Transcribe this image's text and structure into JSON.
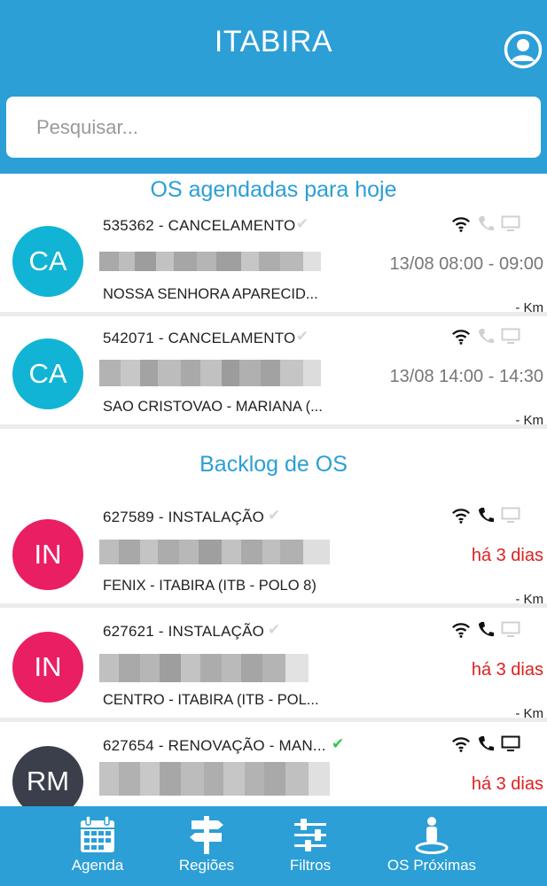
{
  "header": {
    "title": "ITABIRA"
  },
  "search": {
    "placeholder": "Pesquisar..."
  },
  "sections": {
    "today": "OS agendadas para hoje",
    "backlog": "Backlog de OS"
  },
  "orders": [
    {
      "initials": "CA",
      "code": "535362 - CANCELAMENTO",
      "time": "13/08 08:00 - 09:00",
      "place": "NOSSA SENHORA APARECID...",
      "km": "- Km",
      "confirmed": false,
      "phone": false,
      "screen": false,
      "avatar_color": "#11b4d4"
    },
    {
      "initials": "CA",
      "code": "542071 - CANCELAMENTO",
      "time": "13/08 14:00 - 14:30",
      "place": "SAO CRISTOVAO - MARIANA (...",
      "km": "- Km",
      "confirmed": false,
      "phone": false,
      "screen": false,
      "avatar_color": "#11b4d4"
    },
    {
      "initials": "IN",
      "code": "627589 - INSTALAÇÃO",
      "time": "há 3 dias",
      "place": "FENIX - ITABIRA (ITB - POLO 8)",
      "km": "- Km",
      "confirmed": false,
      "phone": true,
      "screen": false,
      "avatar_color": "#e91e63"
    },
    {
      "initials": "IN",
      "code": "627621 - INSTALAÇÃO",
      "time": "há 3 dias",
      "place": "CENTRO - ITABIRA (ITB - POL...",
      "km": "- Km",
      "confirmed": false,
      "phone": true,
      "screen": false,
      "avatar_color": "#e91e63"
    },
    {
      "initials": "RM",
      "code": "627654 - RENOVAÇÃO - MAN...",
      "time": "há 3 dias",
      "place": "",
      "km": "",
      "confirmed": true,
      "phone": true,
      "screen": true,
      "avatar_color": "#3a3f4b"
    }
  ],
  "nav": [
    {
      "label": "Agenda",
      "icon": "calendar-icon"
    },
    {
      "label": "Regiões",
      "icon": "signpost-icon"
    },
    {
      "label": "Filtros",
      "icon": "sliders-icon"
    },
    {
      "label": "OS Próximas",
      "icon": "person-pin-icon"
    }
  ],
  "colors": {
    "primary": "#2b9fd6",
    "late": "#e02020",
    "confirmed": "#2ec64a"
  }
}
